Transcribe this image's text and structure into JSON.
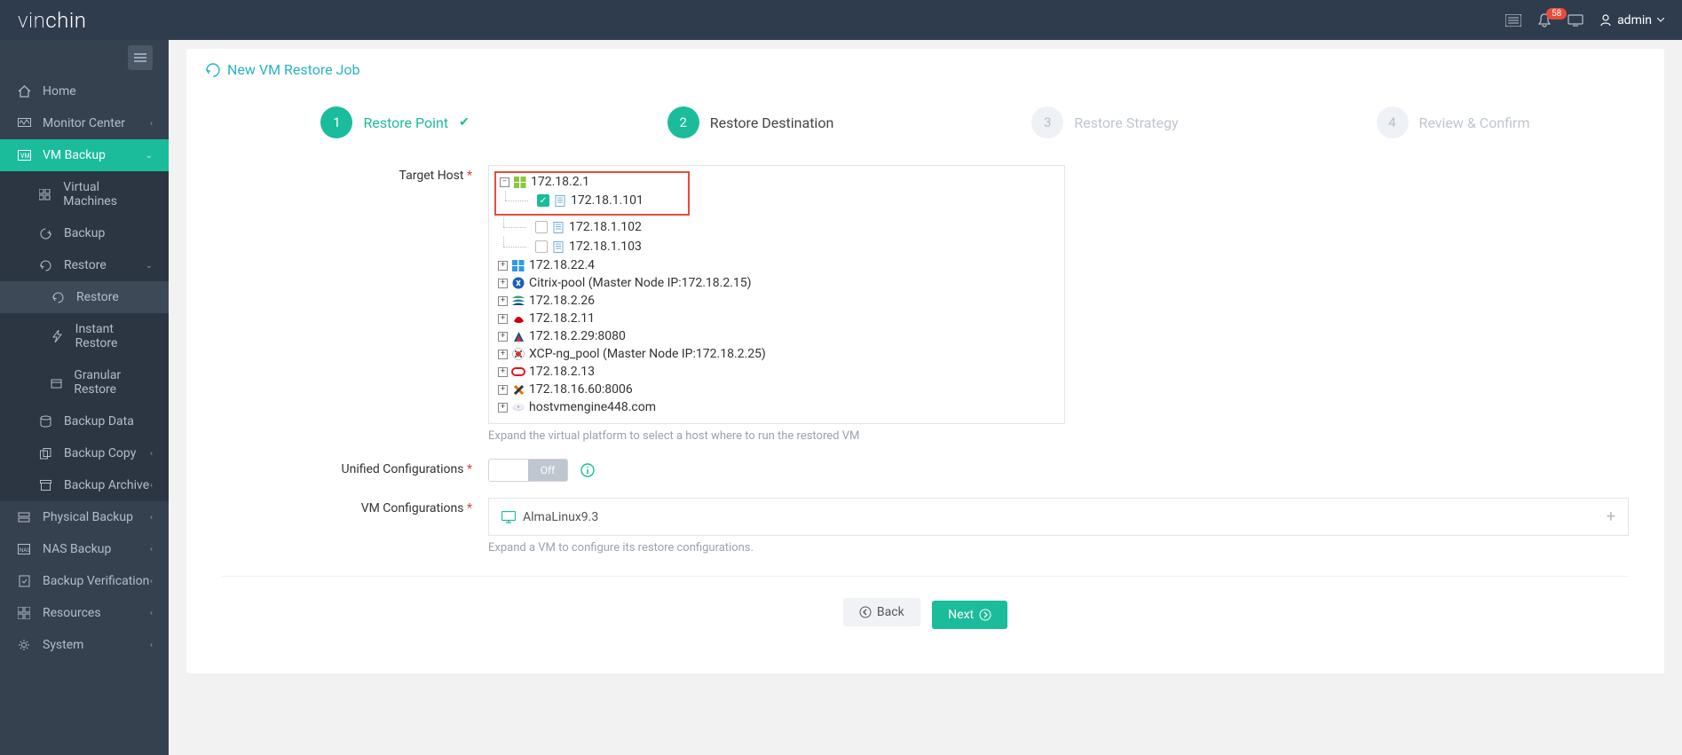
{
  "header": {
    "logo_thin": "vin",
    "logo_bold": "chin",
    "notification_count": "58",
    "user_label": "admin"
  },
  "sidebar": {
    "items": {
      "home": "Home",
      "monitor": "Monitor Center",
      "vmbackup": "VM Backup",
      "virtual_machines": "Virtual Machines",
      "backup": "Backup",
      "restore": "Restore",
      "restore_sub": "Restore",
      "instant_restore": "Instant Restore",
      "granular_restore": "Granular Restore",
      "backup_data": "Backup Data",
      "backup_copy": "Backup Copy",
      "backup_archive": "Backup Archive",
      "physical_backup": "Physical Backup",
      "nas_backup": "NAS Backup",
      "backup_verification": "Backup Verification",
      "resources": "Resources",
      "system": "System"
    }
  },
  "page": {
    "title": "New VM Restore Job",
    "steps": {
      "s1_num": "1",
      "s1_label": "Restore Point",
      "s2_num": "2",
      "s2_label": "Restore Destination",
      "s3_num": "3",
      "s3_label": "Restore Strategy",
      "s4_num": "4",
      "s4_label": "Review & Confirm"
    },
    "form": {
      "target_host_label": "Target Host",
      "target_host_help": "Expand the virtual platform to select a host where to run the restored VM",
      "unified_label": "Unified Configurations",
      "unified_toggle": "Off",
      "vm_config_label": "VM Configurations",
      "vm_config_value": "AlmaLinux9.3",
      "vm_config_help": "Expand a VM to configure its restore configurations."
    },
    "tree": {
      "root1": "172.18.2.1",
      "root1_children": {
        "c1": "172.18.1.101",
        "c2": "172.18.1.102",
        "c3": "172.18.1.103"
      },
      "n2": "172.18.22.4",
      "n3": "Citrix-pool (Master Node IP:172.18.2.15)",
      "n4": "172.18.2.26",
      "n5": "172.18.2.11",
      "n6": "172.18.2.29:8080",
      "n7": "XCP-ng_pool (Master Node IP:172.18.2.25)",
      "n8": "172.18.2.13",
      "n9": "172.18.16.60:8006",
      "n10": "hostvmengine448.com"
    },
    "buttons": {
      "back": "Back",
      "next": "Next"
    }
  },
  "chart_data": null
}
